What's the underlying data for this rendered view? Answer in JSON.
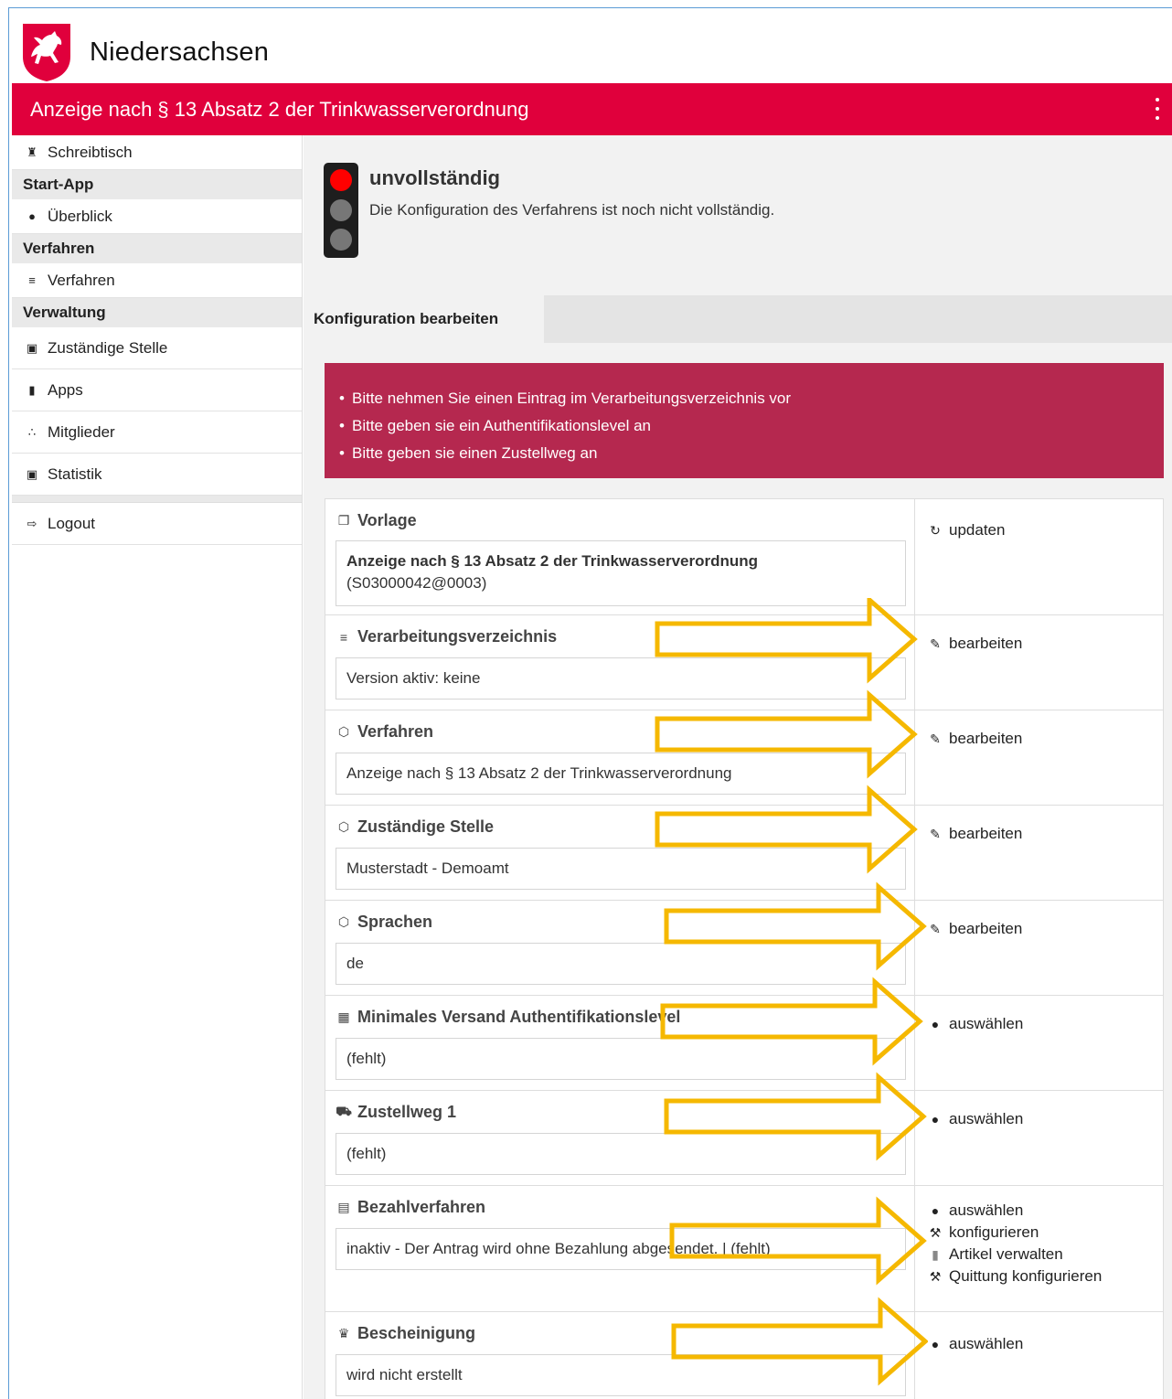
{
  "brand": {
    "name": "Niedersachsen"
  },
  "header": {
    "title": "Anzeige nach § 13 Absatz 2 der Trinkwasserverordnung"
  },
  "sidebar": {
    "schreibtisch": "Schreibtisch",
    "start_app_head": "Start-App",
    "ueberblick": "Überblick",
    "verfahren_head": "Verfahren",
    "verfahren": "Verfahren",
    "verwaltung_head": "Verwaltung",
    "zustaendige_stelle": "Zuständige Stelle",
    "apps": "Apps",
    "mitglieder": "Mitglieder",
    "statistik": "Statistik",
    "logout": "Logout"
  },
  "status": {
    "title": "unvollständig",
    "text": "Die Konfiguration des Verfahrens ist noch nicht vollständig."
  },
  "tab": {
    "label": "Konfiguration bearbeiten"
  },
  "alerts": [
    "Bitte nehmen Sie einen Eintrag im Verarbeitungsverzeichnis vor",
    "Bitte geben sie ein Authentifikationslevel an",
    "Bitte geben sie einen Zustellweg an"
  ],
  "rows": {
    "vorlage": {
      "label": "Vorlage",
      "value_line1": "Anzeige nach § 13 Absatz 2 der Trinkwasserverordnung",
      "value_line2": "(S03000042@0003)",
      "action": "updaten"
    },
    "verarbeitung": {
      "label": "Verarbeitungsverzeichnis",
      "value": "Version aktiv: keine",
      "action": "bearbeiten"
    },
    "verfahren": {
      "label": "Verfahren",
      "value": "Anzeige nach § 13 Absatz 2 der Trinkwasserverordnung",
      "action": "bearbeiten"
    },
    "stelle": {
      "label": "Zuständige Stelle",
      "value": "Musterstadt - Demoamt",
      "action": "bearbeiten"
    },
    "sprachen": {
      "label": "Sprachen",
      "value": "de",
      "action": "bearbeiten"
    },
    "auth": {
      "label": "Minimales Versand Authentifikationslevel",
      "value": "(fehlt)",
      "action": "auswählen"
    },
    "zustellweg": {
      "label": "Zustellweg 1",
      "value": "(fehlt)",
      "action": "auswählen"
    },
    "bezahl": {
      "label": "Bezahlverfahren",
      "value": "inaktiv - Der Antrag wird ohne Bezahlung abgesendet. | (fehlt)",
      "action1": "auswählen",
      "action2": "konfigurieren",
      "action3": "Artikel verwalten",
      "action4": "Quittung konfigurieren"
    },
    "bescheinigung": {
      "label": "Bescheinigung",
      "value": "wird nicht erstellt",
      "action": "auswählen"
    }
  },
  "colors": {
    "header": "#e0003c",
    "alert": "#b5284f",
    "arrow": "#f5b800"
  },
  "icons": {
    "home": "home-icon",
    "bulb": "lightbulb-icon",
    "list": "list-icon",
    "building": "building-icon",
    "book": "book-icon",
    "users": "users-icon",
    "chart": "chart-icon",
    "logout": "logout-icon",
    "copy": "copy-icon",
    "cube": "cube-icon",
    "idcard": "idcard-icon",
    "truck": "truck-icon",
    "card": "credit-card-icon",
    "crown": "crown-icon",
    "refresh": "refresh-icon",
    "pencil": "pencil-icon",
    "toggle": "toggle-icon",
    "wrench": "wrench-icon",
    "barcode": "barcode-icon"
  }
}
